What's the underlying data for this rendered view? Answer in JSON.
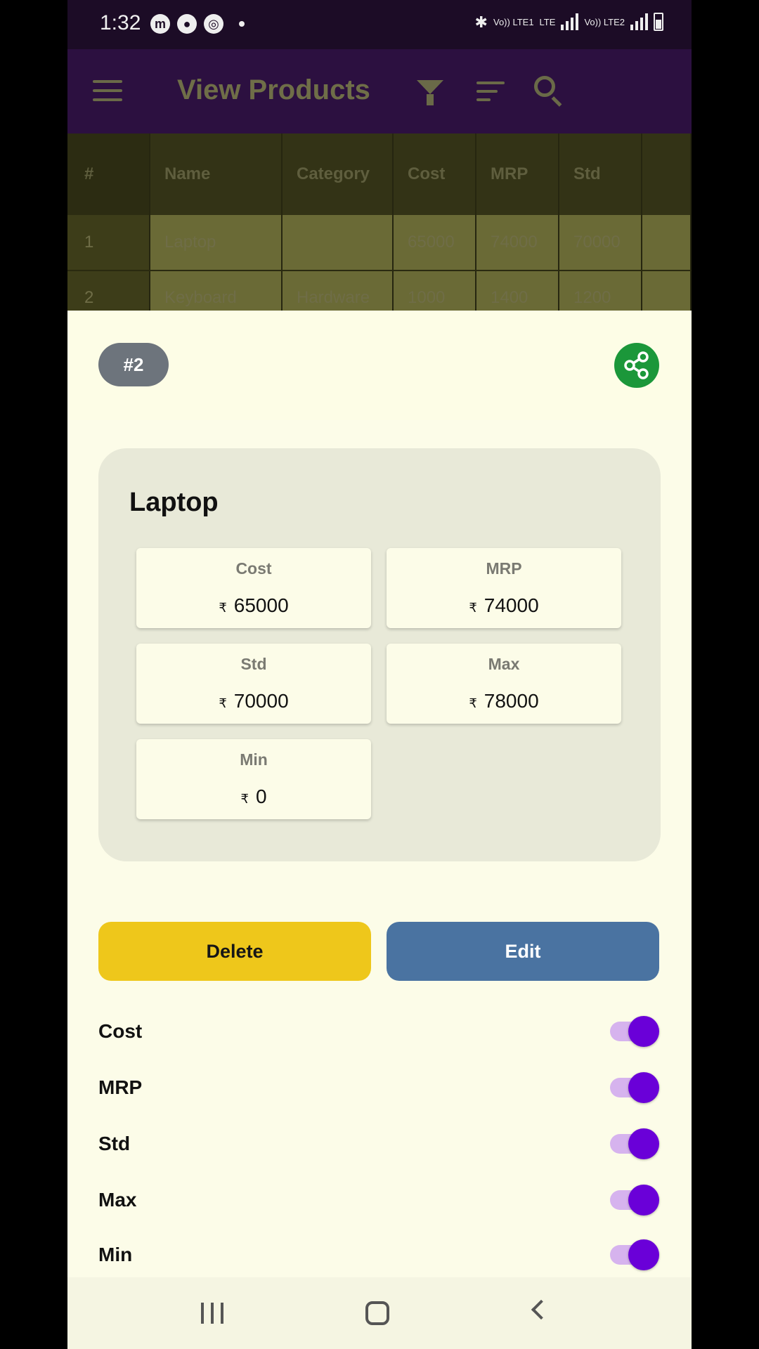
{
  "status_bar": {
    "time": "1:32",
    "left_icons": [
      "messenger-icon",
      "contact-icon",
      "target-icon"
    ],
    "network": {
      "sim1": "Vo)) LTE1",
      "sim2": "Vo)) LTE2",
      "lte": "LTE"
    }
  },
  "app_bar": {
    "title": "View Products",
    "icons": [
      "menu-icon",
      "filter-icon",
      "sort-icon",
      "search-icon"
    ]
  },
  "table": {
    "columns": [
      "#",
      "Name",
      "Category",
      "Cost",
      "MRP",
      "Std"
    ],
    "rows": [
      [
        "1",
        "Laptop",
        "",
        "65000",
        "74000",
        "70000"
      ],
      [
        "2",
        "Keyboard",
        "Hardware",
        "1000",
        "1400",
        "1200"
      ]
    ]
  },
  "sheet": {
    "badge": "#2",
    "product_name": "Laptop",
    "currency_symbol": "₹",
    "stats": [
      {
        "label": "Cost",
        "value": "65000"
      },
      {
        "label": "MRP",
        "value": "74000"
      },
      {
        "label": "Std",
        "value": "70000"
      },
      {
        "label": "Max",
        "value": "78000"
      },
      {
        "label": "Min",
        "value": "0"
      }
    ],
    "delete_label": "Delete",
    "edit_label": "Edit",
    "toggles": [
      {
        "label": "Cost",
        "on": true
      },
      {
        "label": "MRP",
        "on": true
      },
      {
        "label": "Std",
        "on": true
      },
      {
        "label": "Max",
        "on": true
      },
      {
        "label": "Min",
        "on": true
      }
    ]
  },
  "colors": {
    "accent_purple": "#6a00d8",
    "delete_yellow": "#eec71b",
    "edit_blue": "#4a73a1",
    "share_green": "#1b973a"
  }
}
